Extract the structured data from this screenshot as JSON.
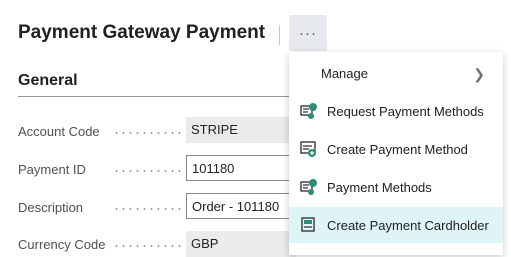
{
  "header": {
    "title": "Payment Gateway Payment",
    "more_label": "···"
  },
  "section": {
    "title": "General"
  },
  "fields": [
    {
      "label": "Account Code",
      "value": "STRIPE"
    },
    {
      "label": "Payment ID",
      "value": "101180"
    },
    {
      "label": "Description",
      "value": "Order - 101180"
    },
    {
      "label": "Currency Code",
      "value": "GBP"
    }
  ],
  "menu": {
    "manage_label": "Manage",
    "items": [
      {
        "label": "Request Payment Methods",
        "icon": "request-payment-methods-icon"
      },
      {
        "label": "Create Payment Method",
        "icon": "create-payment-method-icon"
      },
      {
        "label": "Payment Methods",
        "icon": "payment-methods-icon"
      },
      {
        "label": "Create Payment Cardholder",
        "icon": "create-payment-cardholder-icon"
      }
    ],
    "highlight_color": "#dff4f6",
    "icon_accent": "#2f8c7d"
  }
}
